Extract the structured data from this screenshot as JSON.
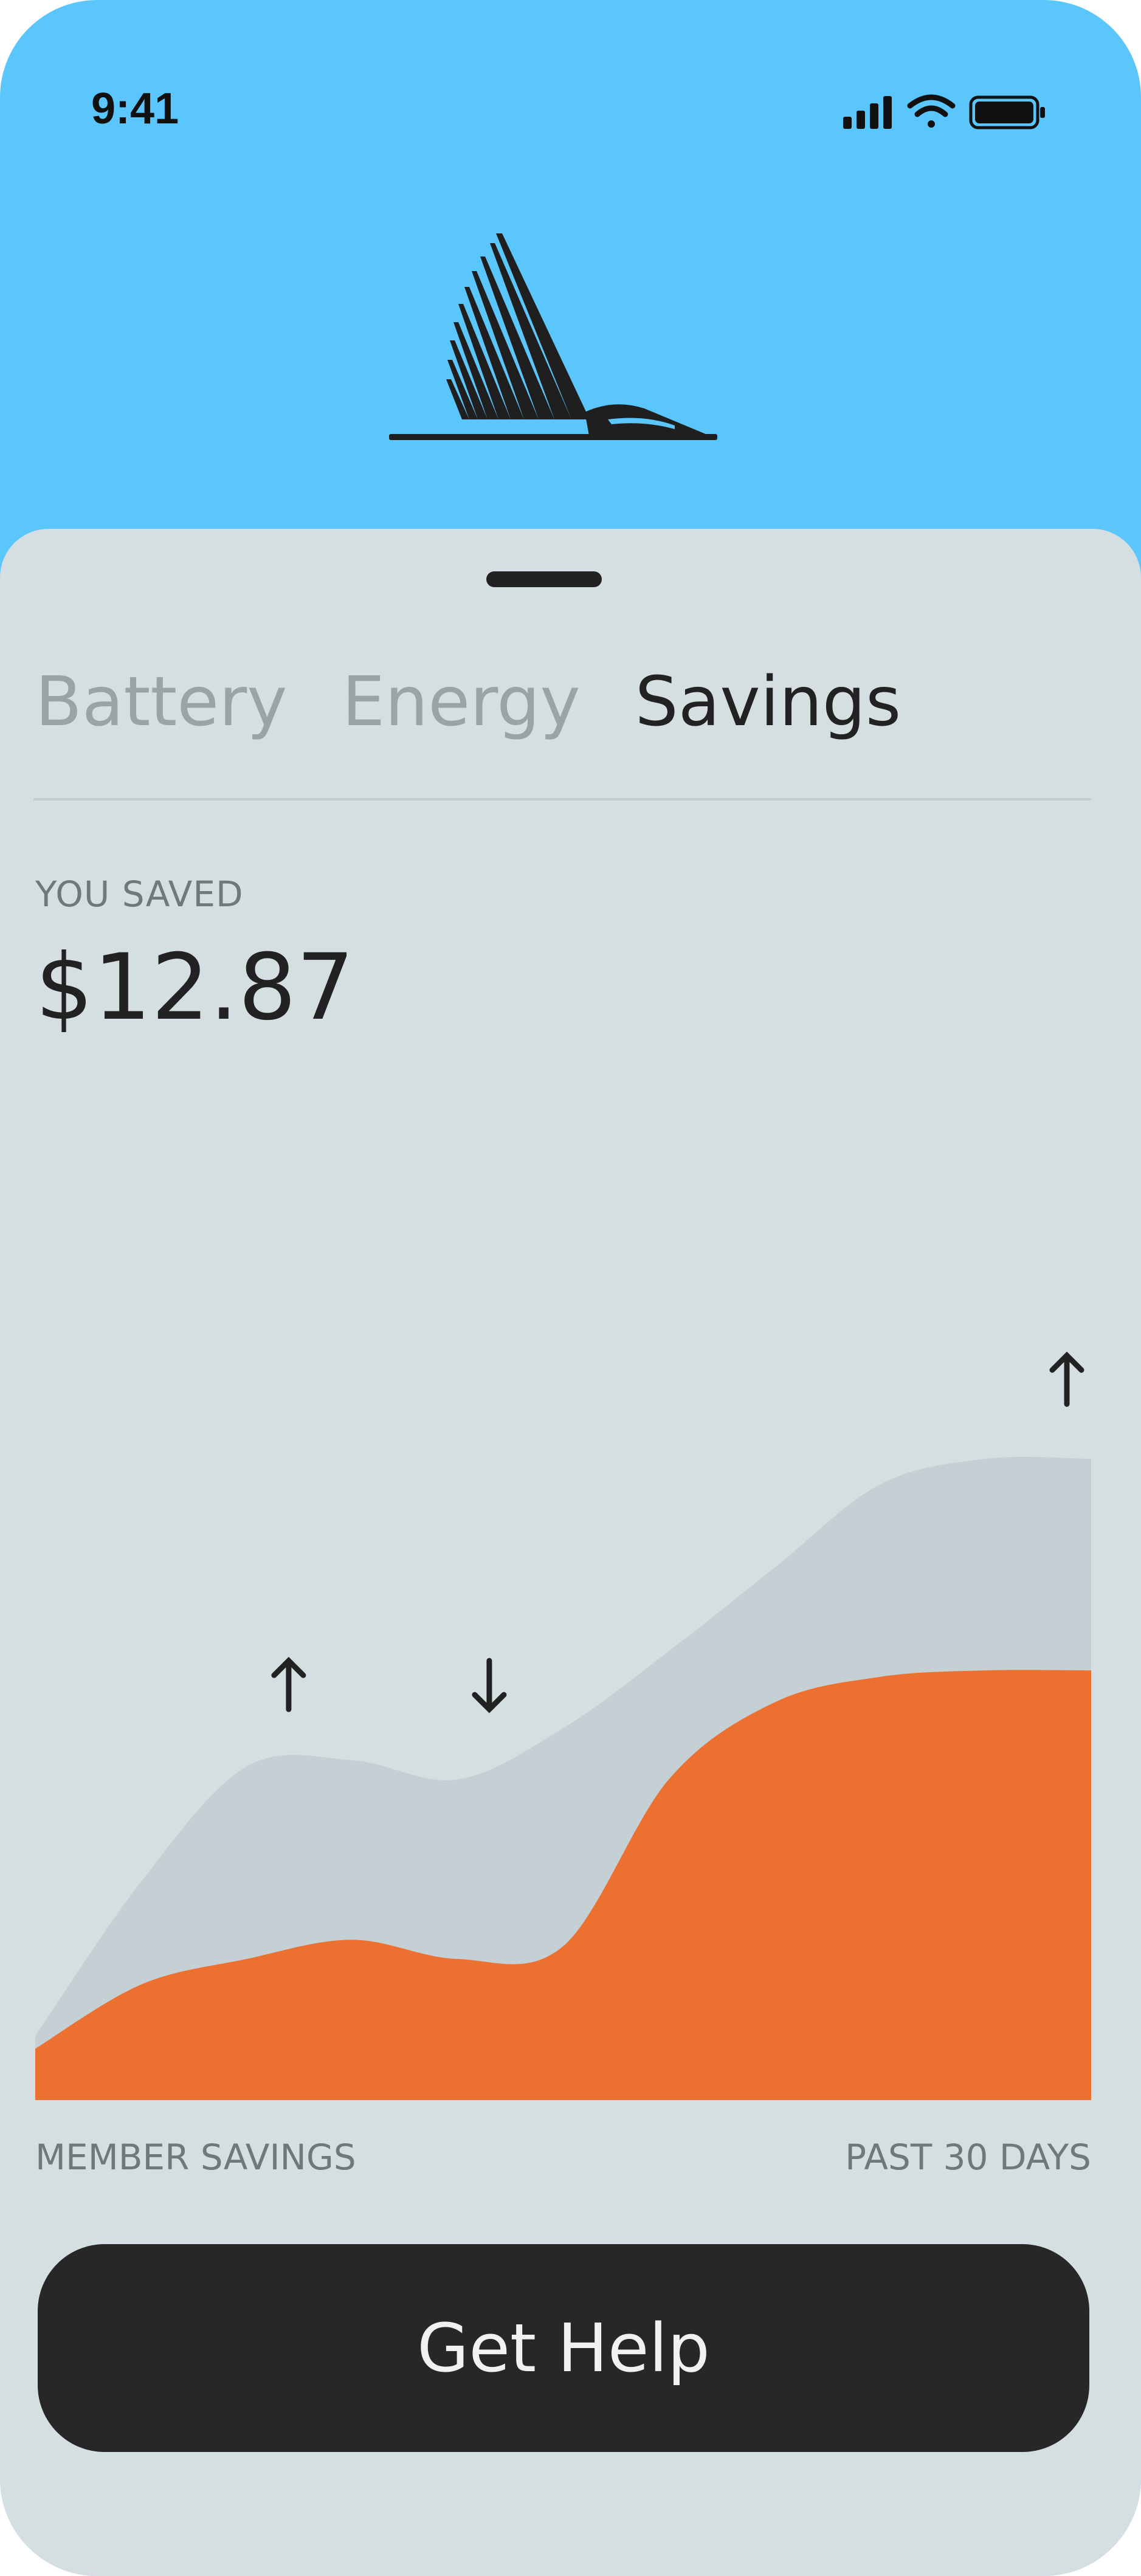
{
  "status_bar": {
    "time": "9:41",
    "icons": [
      "cellular-signal-icon",
      "wifi-icon",
      "battery-icon"
    ]
  },
  "header": {
    "logo": "bird-wing-logo",
    "background": "#5bc6fb"
  },
  "tabs": [
    {
      "label": "Battery",
      "active": false
    },
    {
      "label": "Energy",
      "active": false
    },
    {
      "label": "Savings",
      "active": true
    }
  ],
  "savings": {
    "label": "YOU SAVED",
    "value": "$12.87"
  },
  "chart_data": {
    "type": "area",
    "x": [
      0,
      10,
      20,
      30,
      40,
      50,
      60,
      70,
      80,
      90,
      100
    ],
    "series": [
      {
        "values": [
          0.1,
          0.34,
          0.52,
          0.53,
          0.5,
          0.58,
          0.7,
          0.83,
          0.96,
          1.0,
          1.0
        ],
        "color": "#c4d0d3"
      },
      {
        "values": [
          0.08,
          0.18,
          0.22,
          0.25,
          0.22,
          0.24,
          0.5,
          0.62,
          0.66,
          0.67,
          0.67
        ],
        "color": "#ec7030"
      }
    ],
    "arrows": [
      {
        "direction": "up",
        "x": 24
      },
      {
        "direction": "down",
        "x": 43
      },
      {
        "direction": "up",
        "x": 100
      }
    ],
    "ylim": [
      0,
      1
    ],
    "grid": false
  },
  "footer": {
    "left_label": "MEMBER SAVINGS",
    "right_label": "PAST 30 DAYS"
  },
  "help_button": {
    "label": "Get Help"
  }
}
